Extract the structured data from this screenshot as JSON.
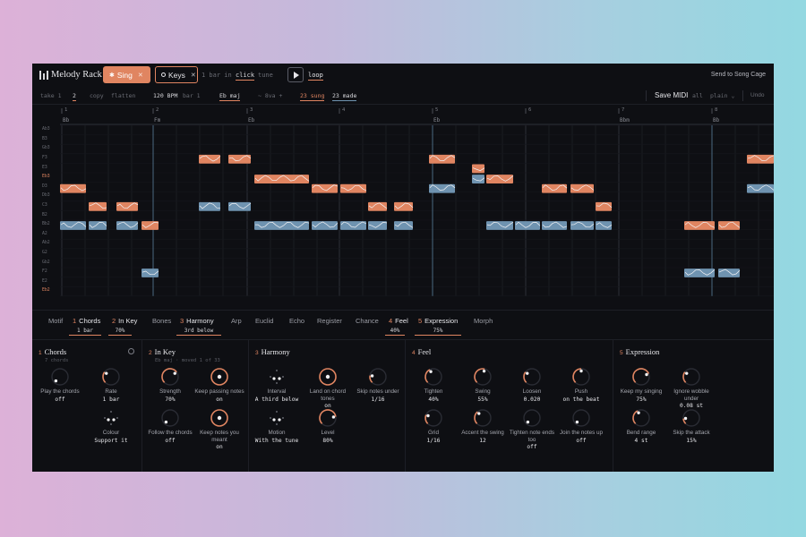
{
  "app": {
    "title": "Melody Rack",
    "send_label": "Send to Song Cage"
  },
  "topbar": {
    "sing_label": "Sing",
    "keys_label": "Keys",
    "hints": [
      "1 bar in",
      "click",
      "tune"
    ],
    "loop_label": "loop"
  },
  "bar2": {
    "take_label": "take 1",
    "take_value": "2",
    "copy_label": "copy",
    "flatten_label": "flatten",
    "bpm": "120 BPM",
    "bar_label": "bar 1",
    "key": "Eb maj",
    "octave": "~ 8va +",
    "sung": "23 sung",
    "made": "23 made",
    "save_midi": "Save MIDI",
    "all_label": "all",
    "plain_label": "plain ⌄",
    "undo_label": "Undo"
  },
  "roll": {
    "bars": [
      "1",
      "2",
      "3",
      "4",
      "5",
      "6",
      "7",
      "8"
    ],
    "chords": [
      "Bb",
      "Fm",
      "Eb",
      "Eb",
      "Bbm",
      "Bb"
    ],
    "notes": [
      "Ab3",
      "B3",
      "Gb3",
      "F3",
      "E3",
      "Eb3",
      "D3",
      "Db3",
      "C3",
      "B2",
      "Bb2",
      "A2",
      "Ab2",
      "G2",
      "Gb2",
      "F2",
      "E2",
      "Eb2"
    ]
  },
  "tabs": [
    {
      "num": "",
      "label": "Motif",
      "sub": ""
    },
    {
      "num": "1",
      "label": "Chords",
      "sub": "1 bar"
    },
    {
      "num": "2",
      "label": "In Key",
      "sub": "70%"
    },
    {
      "num": "",
      "label": "Bones",
      "sub": ""
    },
    {
      "num": "3",
      "label": "Harmony",
      "sub": "3rd below"
    },
    {
      "num": "",
      "label": "Arp",
      "sub": ""
    },
    {
      "num": "",
      "label": "Euclid",
      "sub": ""
    },
    {
      "num": "",
      "label": "Echo",
      "sub": ""
    },
    {
      "num": "",
      "label": "Register",
      "sub": ""
    },
    {
      "num": "",
      "label": "Chance",
      "sub": ""
    },
    {
      "num": "4",
      "label": "Feel",
      "sub": "40%"
    },
    {
      "num": "5",
      "label": "Expression",
      "sub": "75%"
    },
    {
      "num": "",
      "label": "Morph",
      "sub": ""
    }
  ],
  "panels": {
    "chords": {
      "num": "1",
      "title": "Chords",
      "sub": "7 chords",
      "knobs": [
        {
          "label": "Play the chords",
          "value": "off",
          "level": 0
        },
        {
          "label": "Rate",
          "value": "1 bar",
          "level": 0.3
        },
        {
          "label": "Colour",
          "value": "Support it",
          "level": 0.5
        }
      ]
    },
    "inkey": {
      "num": "2",
      "title": "In Key",
      "sub": "Eb maj · moved 1 of 33",
      "knobs": [
        {
          "label": "Strength",
          "value": "70%",
          "level": 0.7
        },
        {
          "label": "Keep passing notes",
          "value": "on",
          "level": 1
        },
        {
          "label": "Follow the chords",
          "value": "off",
          "level": 0
        },
        {
          "label": "Keep notes you meant",
          "value": "on",
          "level": 1
        }
      ]
    },
    "harmony": {
      "num": "3",
      "title": "Harmony",
      "sub": "",
      "knobs": [
        {
          "label": "Interval",
          "value": "A third below",
          "level": 0.45
        },
        {
          "label": "Land on chord tones",
          "value": "on",
          "level": 1
        },
        {
          "label": "Skip notes under",
          "value": "1/16",
          "level": 0.2
        },
        {
          "label": "Motion",
          "value": "With the tune",
          "level": 0.4
        },
        {
          "label": "Level",
          "value": "80%",
          "level": 0.8
        }
      ]
    },
    "feel": {
      "num": "4",
      "title": "Feel",
      "sub": "",
      "knobs": [
        {
          "label": "Tighten",
          "value": "40%",
          "level": 0.4
        },
        {
          "label": "Swing",
          "value": "55%",
          "level": 0.55
        },
        {
          "label": "Loosen",
          "value": "0.020",
          "level": 0.3
        },
        {
          "label": "Push",
          "value": "on the beat",
          "level": 0.5
        },
        {
          "label": "Grid",
          "value": "1/16",
          "level": 0.25
        },
        {
          "label": "Accent the swing",
          "value": "12",
          "level": 0.35
        },
        {
          "label": "Tighten note ends too",
          "value": "off",
          "level": 0
        },
        {
          "label": "Join the notes up",
          "value": "off",
          "level": 0
        }
      ]
    },
    "expression": {
      "num": "5",
      "title": "Expression",
      "sub": "",
      "knobs": [
        {
          "label": "Keep my singing",
          "value": "75%",
          "level": 0.75
        },
        {
          "label": "Ignore wobble under",
          "value": "0.08 st",
          "level": 0.3
        },
        {
          "label": "Bend range",
          "value": "4 st",
          "level": 0.4
        },
        {
          "label": "Skip the attack",
          "value": "15%",
          "level": 0.15
        }
      ]
    }
  },
  "colors": {
    "sung": "#e08561",
    "made": "#6f93b0",
    "bg": "#0e0f13"
  }
}
